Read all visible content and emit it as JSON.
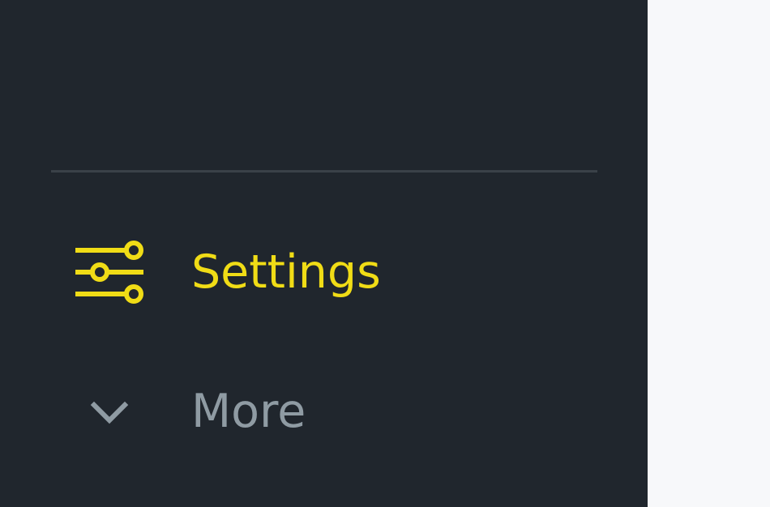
{
  "sidebar": {
    "items": [
      {
        "label": "Settings",
        "icon": "sliders-icon",
        "color": "#f0dc16"
      },
      {
        "label": "More",
        "icon": "chevron-down-icon",
        "color": "#8f9ba3"
      }
    ]
  },
  "colors": {
    "sidebar_bg": "#20262d",
    "accent": "#f0dc16",
    "muted": "#8f9ba3",
    "divider": "#3a4148",
    "main_bg": "#f7f8fa"
  }
}
